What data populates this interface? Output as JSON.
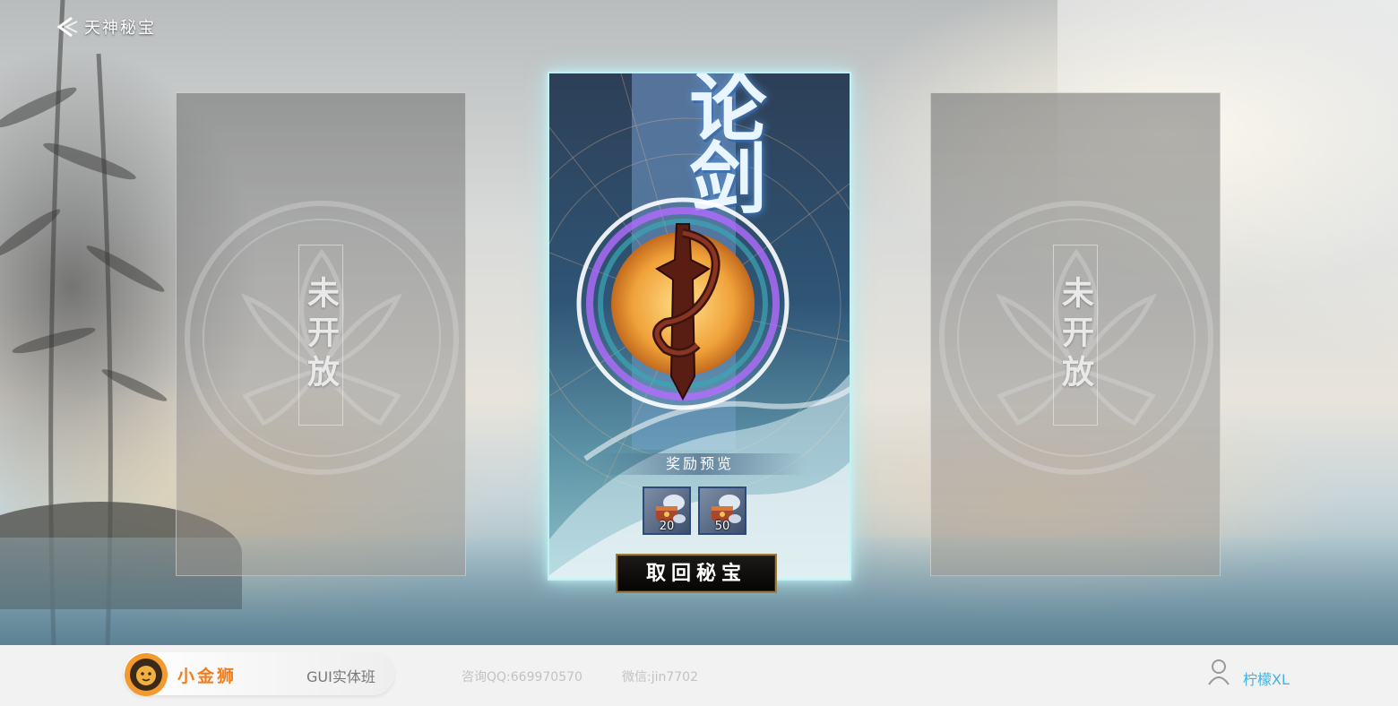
{
  "header": {
    "back_icon": "back-arrow-icon",
    "title": "天神秘宝"
  },
  "cards": {
    "locked_left": {
      "status": "未开放",
      "emblem_icon": "lotus-emblem-icon"
    },
    "active": {
      "title": "论剑",
      "emblem_icon": "dragon-sword-emblem-icon",
      "reward_header": "奖励预览",
      "rewards": [
        {
          "icon": "treasure-chest-icon",
          "count": "20"
        },
        {
          "icon": "treasure-chest-icon",
          "count": "50"
        }
      ],
      "button_label": "取回秘宝"
    },
    "locked_right": {
      "status": "未开放",
      "emblem_icon": "lotus-emblem-icon"
    }
  },
  "footer": {
    "logo_icon": "lion-logo-icon",
    "brand_name": "小金狮",
    "course": "GUI实体班",
    "qq": "咨询QQ:669970570",
    "wechat": "微信:jin7702",
    "user_icon": "user-icon",
    "user_name": "柠檬XL"
  },
  "colors": {
    "accent_glow": "#bdf3f4",
    "button_border": "#9c7a3b",
    "brand_orange": "#f07d1e",
    "user_blue": "#3fb2e8"
  }
}
